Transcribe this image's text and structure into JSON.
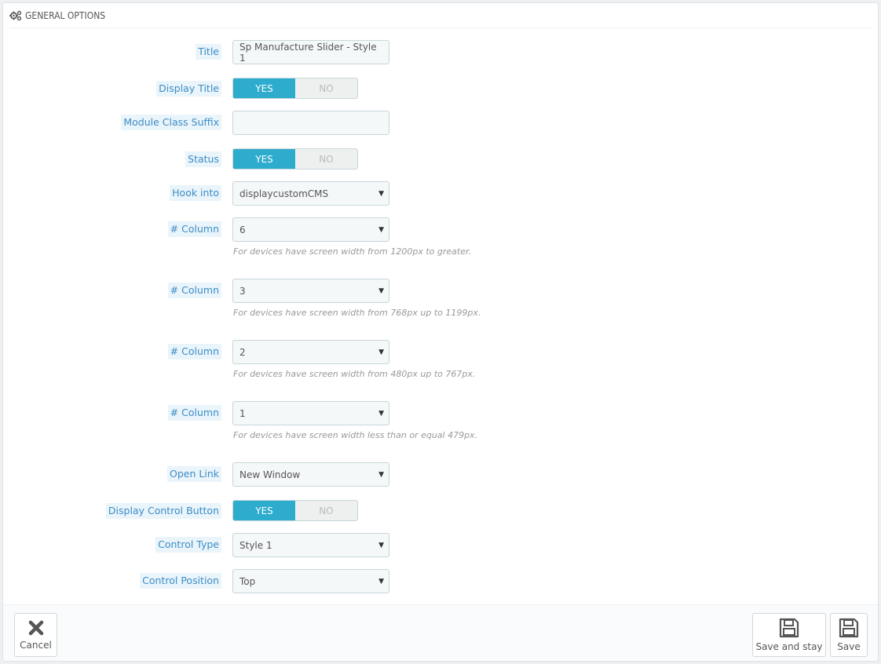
{
  "panel": {
    "heading_icon": "cogs-icon",
    "heading": "GENERAL OPTIONS"
  },
  "form": {
    "title_label": "Title",
    "title_value": "Sp Manufacture Slider - Style 1",
    "display_title_label": "Display Title",
    "display_title": {
      "yes": "YES",
      "no": "NO",
      "selected": "YES"
    },
    "suffix_label": "Module Class Suffix",
    "suffix_value": "",
    "status_label": "Status",
    "status": {
      "yes": "YES",
      "no": "NO",
      "selected": "YES"
    },
    "hook_label": "Hook into",
    "hook_value": "displaycustomCMS",
    "columns": [
      {
        "label": "# Column",
        "value": "6",
        "help": "For devices have screen width from 1200px to greater."
      },
      {
        "label": "# Column",
        "value": "3",
        "help": "For devices have screen width from 768px up to 1199px."
      },
      {
        "label": "# Column",
        "value": "2",
        "help": "For devices have screen width from 480px up to 767px."
      },
      {
        "label": "# Column",
        "value": "1",
        "help": "For devices have screen width less than or equal 479px."
      }
    ],
    "open_link_label": "Open Link",
    "open_link_value": "New Window",
    "display_control_label": "Display Control Button",
    "display_control": {
      "yes": "YES",
      "no": "NO",
      "selected": "YES"
    },
    "control_type_label": "Control Type",
    "control_type_value": "Style 1",
    "control_position_label": "Control Position",
    "control_position_value": "Top"
  },
  "footer": {
    "cancel_label": "Cancel",
    "cancel_icon": "close-icon",
    "save_stay_label": "Save and stay",
    "save_label": "Save",
    "save_icon": "floppy-disk-icon"
  },
  "colors": {
    "accent": "#2eacce",
    "label_bg": "#eaf4fb",
    "label_text": "#3c8dc5"
  }
}
